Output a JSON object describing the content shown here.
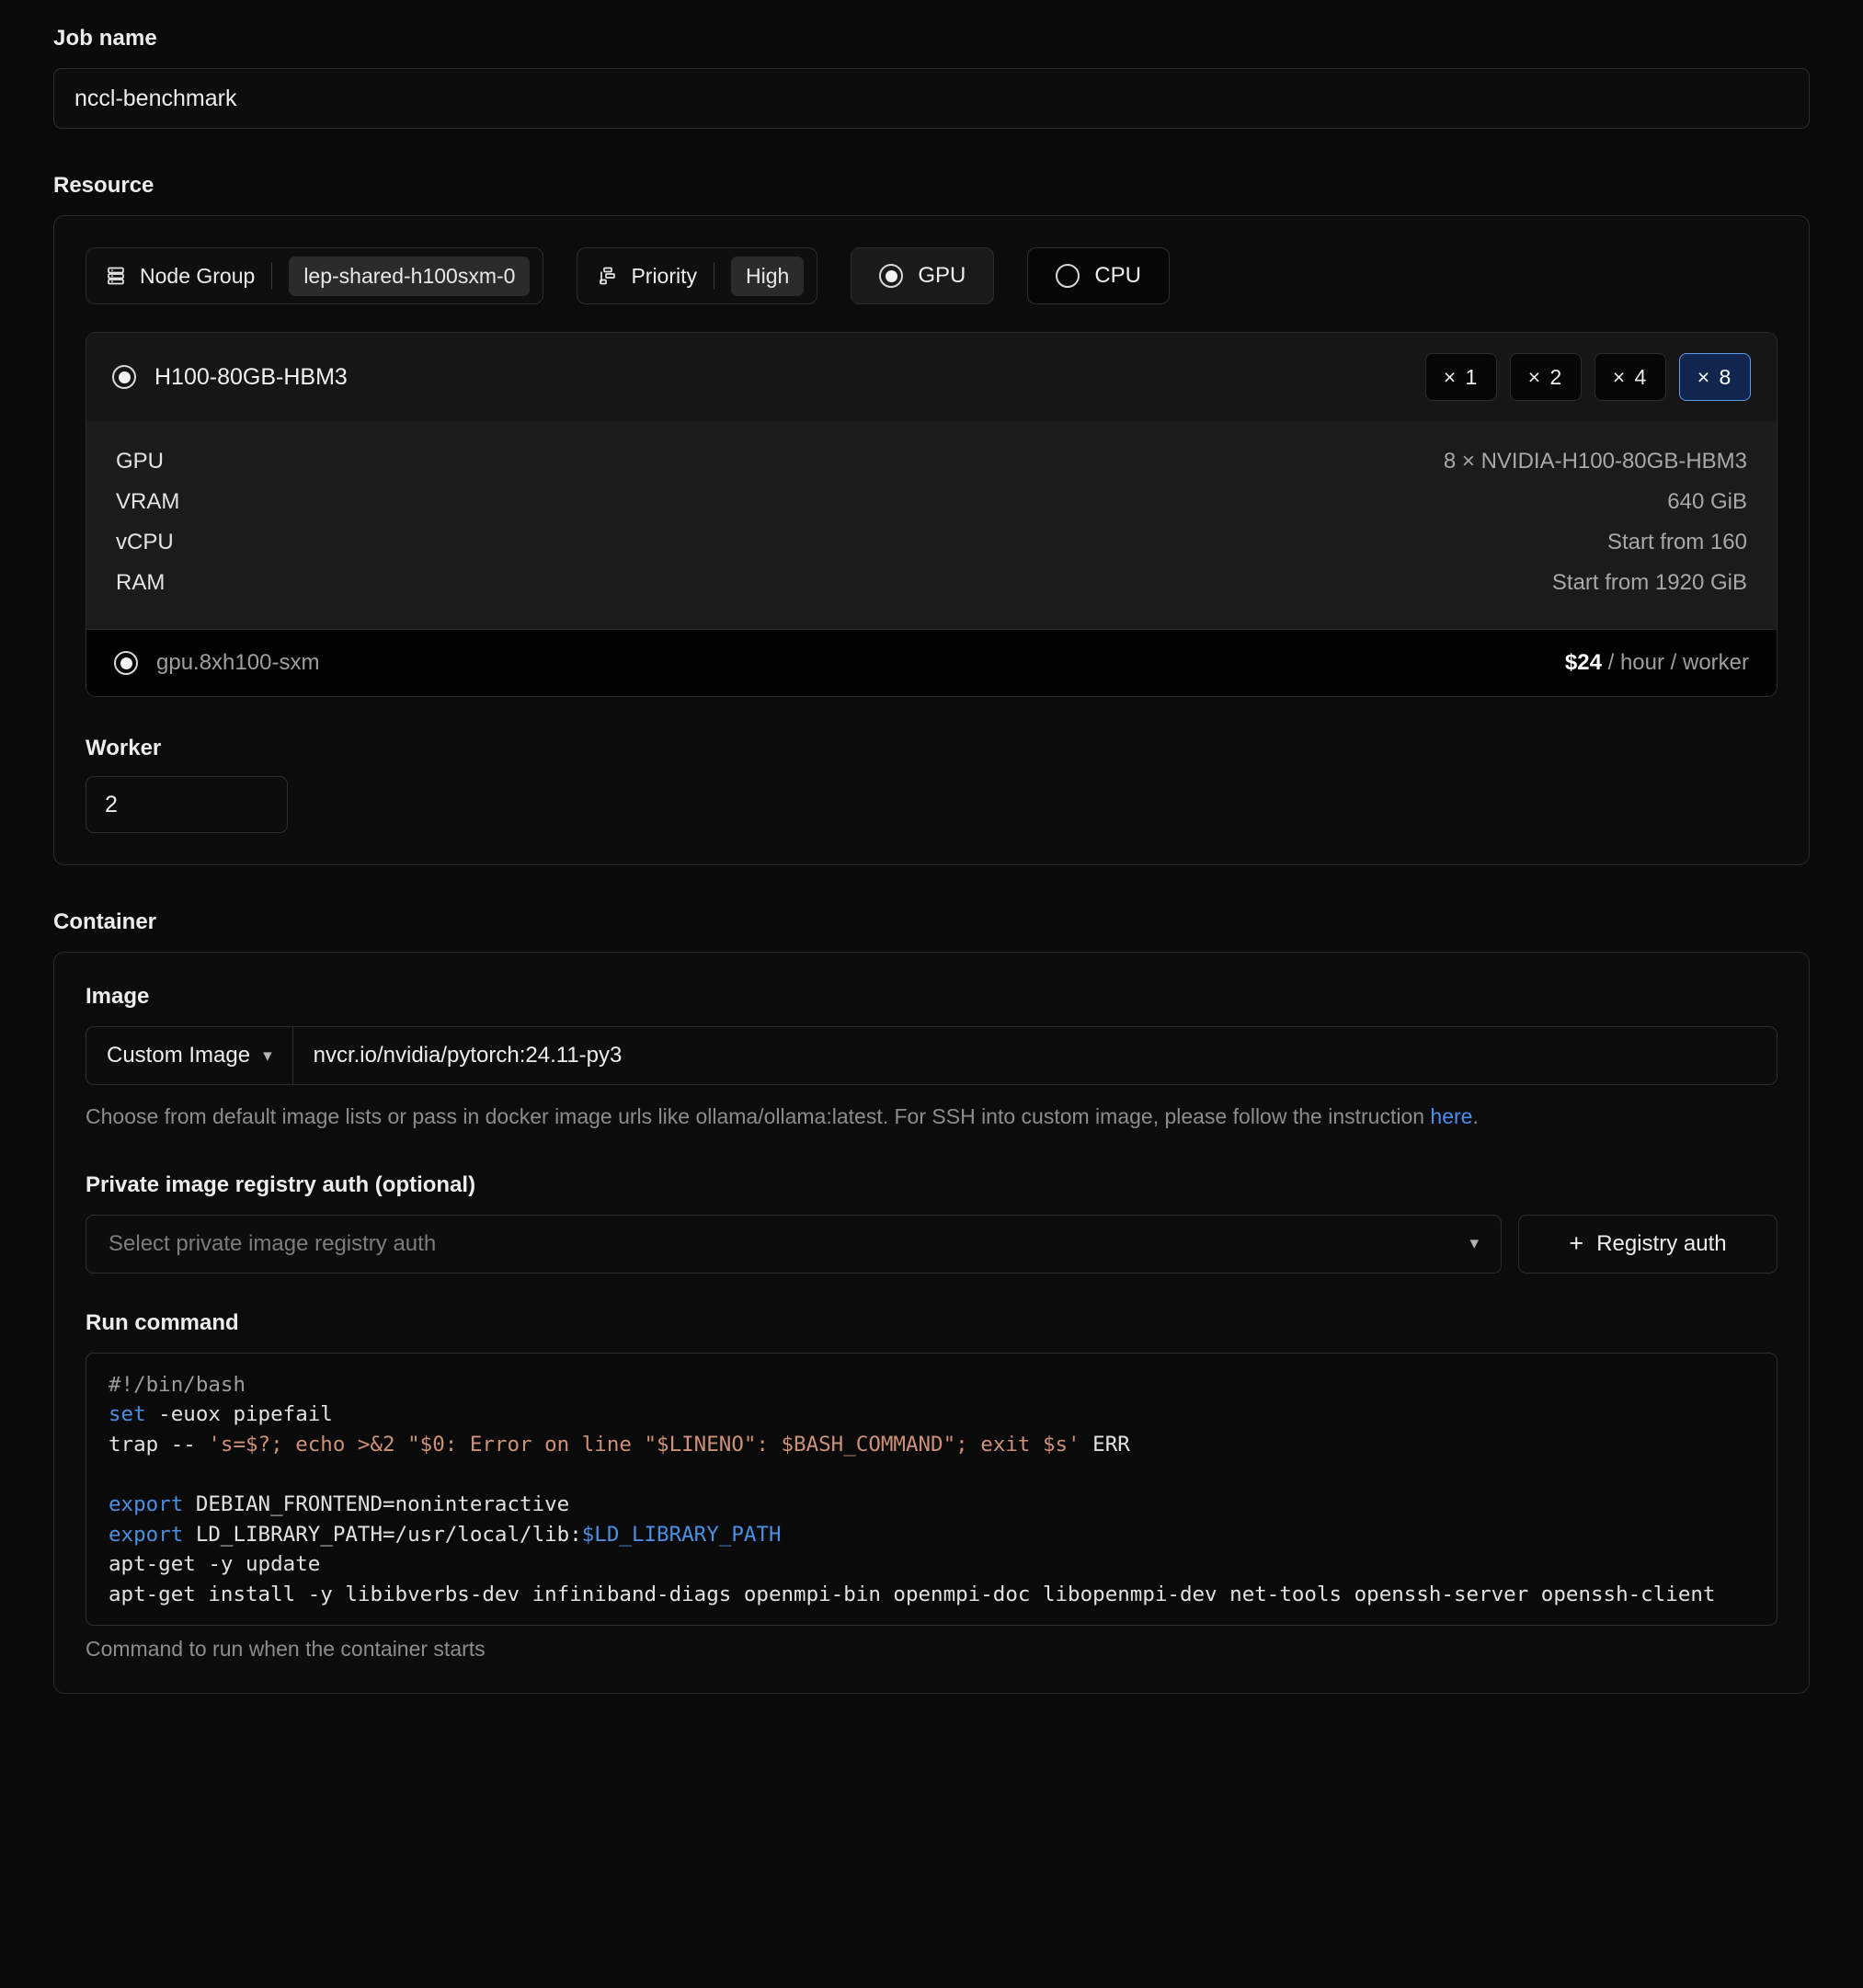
{
  "job": {
    "label": "Job name",
    "value": "nccl-benchmark"
  },
  "resource": {
    "section_title": "Resource",
    "node_group": {
      "icon": "server-stack-icon",
      "label": "Node Group",
      "value": "lep-shared-h100sxm-0"
    },
    "priority": {
      "icon": "priority-levels-icon",
      "label": "Priority",
      "value": "High"
    },
    "compute_type": [
      {
        "label": "GPU",
        "selected": true
      },
      {
        "label": "CPU",
        "selected": false
      }
    ],
    "gpu": {
      "name": "H100-80GB-HBM3",
      "selected": true,
      "quantities": [
        {
          "label": "× 1",
          "selected": false
        },
        {
          "label": "× 2",
          "selected": false
        },
        {
          "label": "× 4",
          "selected": false
        },
        {
          "label": "× 8",
          "selected": true
        }
      ],
      "specs": [
        {
          "key": "GPU",
          "value": "8 × NVIDIA-H100-80GB-HBM3"
        },
        {
          "key": "VRAM",
          "value": "640 GiB"
        },
        {
          "key": "vCPU",
          "value": "Start from 160"
        },
        {
          "key": "RAM",
          "value": "Start from 1920 GiB"
        }
      ],
      "plan": {
        "name": "gpu.8xh100-sxm",
        "selected": true,
        "price": "$24",
        "price_unit": " / hour / worker"
      }
    },
    "worker": {
      "label": "Worker",
      "value": "2"
    }
  },
  "container": {
    "section_title": "Container",
    "image": {
      "label": "Image",
      "select_value": "Custom Image",
      "url_value": "nvcr.io/nvidia/pytorch:24.11-py3",
      "help_prefix": "Choose from default image lists or pass in docker image urls like ollama/ollama:latest. For SSH into custom image, please follow the instruction ",
      "help_link": "here",
      "help_suffix": "."
    },
    "registry_auth": {
      "label": "Private image registry auth (optional)",
      "placeholder": "Select private image registry auth",
      "button_label": "Registry auth"
    },
    "run_command": {
      "label": "Run command",
      "hint": "Command to run when the container starts",
      "lines": [
        [
          {
            "t": "#!/bin/bash",
            "c": "comment"
          }
        ],
        [
          {
            "t": "set",
            "c": "kw"
          },
          {
            "t": " -euox pipefail",
            "c": "plain"
          }
        ],
        [
          {
            "t": "trap -- ",
            "c": "plain"
          },
          {
            "t": "'s=$?; echo >&2 \"$0: Error on line \"$LINENO\": $BASH_COMMAND\"; exit $s'",
            "c": "str"
          },
          {
            "t": " ERR",
            "c": "plain"
          }
        ],
        [
          {
            "t": "",
            "c": "plain"
          }
        ],
        [
          {
            "t": "export",
            "c": "kw"
          },
          {
            "t": " DEBIAN_FRONTEND=noninteractive",
            "c": "plain"
          }
        ],
        [
          {
            "t": "export",
            "c": "kw"
          },
          {
            "t": " LD_LIBRARY_PATH=/usr/local/lib:",
            "c": "plain"
          },
          {
            "t": "$LD_LIBRARY_PATH",
            "c": "var"
          }
        ],
        [
          {
            "t": "apt-get -y update",
            "c": "plain"
          }
        ],
        [
          {
            "t": "apt-get install -y libibverbs-dev infiniband-diags openmpi-bin openmpi-doc libopenmpi-dev net-tools openssh-server openssh-client",
            "c": "plain"
          }
        ]
      ]
    }
  },
  "colors": {
    "accent_blue": "#4a8ef0",
    "selected_qty_bg": "#10264f",
    "selected_qty_border": "#5a9bf0",
    "page_bg": "#0a0a0a"
  }
}
